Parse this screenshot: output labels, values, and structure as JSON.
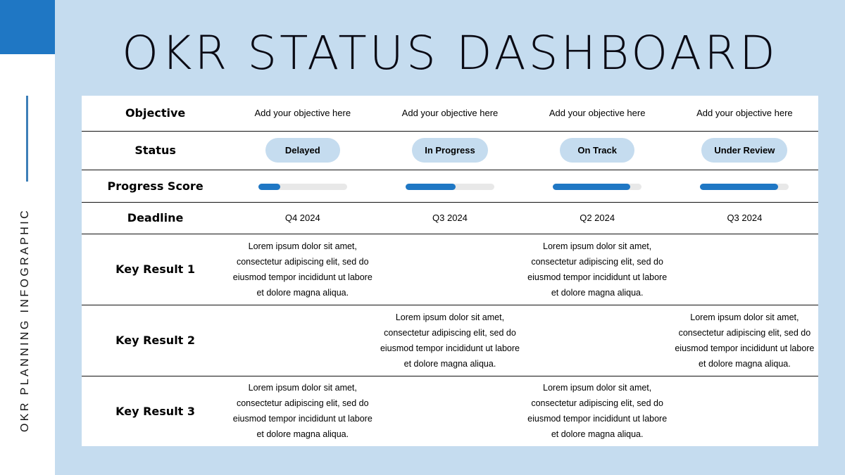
{
  "sidebar": {
    "label": "OKR PLANNING INFOGRAPHIC"
  },
  "title": "OKR STATUS DASHBOARD",
  "colors": {
    "accent": "#1f77c4",
    "background": "#c5dcef",
    "pill": "#c5dcef",
    "track": "#e8e8e8"
  },
  "rows": {
    "objective": "Objective",
    "status": "Status",
    "progress": "Progress Score",
    "deadline": "Deadline",
    "kr1": "Key Result 1",
    "kr2": "Key Result 2",
    "kr3": "Key Result 3"
  },
  "columns": [
    {
      "objective": "Add your objective here",
      "status": "Delayed",
      "progress": 25,
      "deadline": "Q4 2024",
      "kr1": "Lorem ipsum dolor sit amet, consectetur adipiscing elit, sed do eiusmod tempor incididunt ut labore et dolore magna aliqua.",
      "kr2": "",
      "kr3": "Lorem ipsum dolor sit amet, consectetur adipiscing elit, sed do eiusmod tempor incididunt ut labore et dolore magna aliqua."
    },
    {
      "objective": "Add your objective here",
      "status": "In Progress",
      "progress": 56,
      "deadline": "Q3 2024",
      "kr1": "",
      "kr2": "Lorem ipsum dolor sit amet, consectetur adipiscing elit, sed do eiusmod tempor incididunt ut labore et dolore magna aliqua.",
      "kr3": ""
    },
    {
      "objective": "Add your objective here",
      "status": "On Track",
      "progress": 87,
      "deadline": "Q2 2024",
      "kr1": "Lorem ipsum dolor sit amet, consectetur adipiscing elit, sed do eiusmod tempor incididunt ut labore et dolore magna aliqua.",
      "kr2": "",
      "kr3": "Lorem ipsum dolor sit amet, consectetur adipiscing elit, sed do eiusmod tempor incididunt ut labore et dolore magna aliqua."
    },
    {
      "objective": "Add your objective here",
      "status": "Under Review",
      "progress": 88,
      "deadline": "Q3 2024",
      "kr1": "",
      "kr2": "Lorem ipsum dolor sit amet, consectetur adipiscing elit, sed do eiusmod tempor incididunt ut labore et dolore magna aliqua.",
      "kr3": ""
    }
  ]
}
